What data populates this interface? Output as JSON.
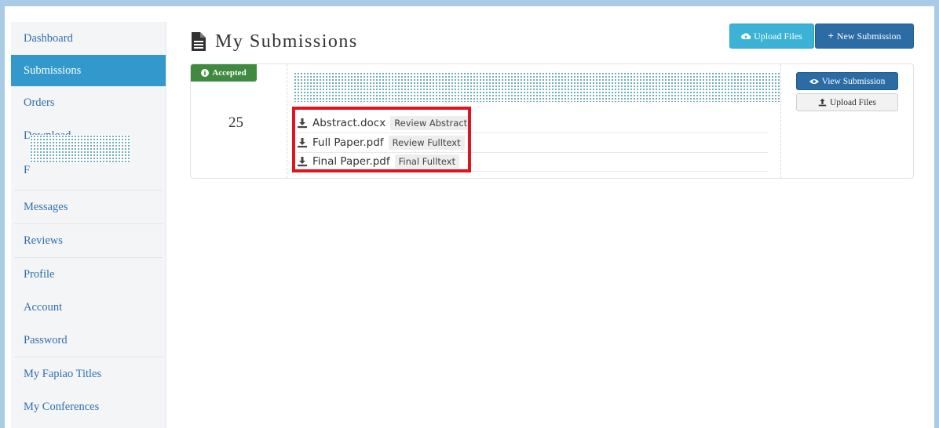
{
  "sidebar": {
    "items": [
      {
        "label": "Dashboard"
      },
      {
        "label": "Submissions"
      },
      {
        "label": "Orders"
      },
      {
        "label": "Download"
      },
      {
        "label": "F"
      },
      {
        "label": "Messages"
      },
      {
        "label": "Reviews"
      },
      {
        "label": "Profile"
      },
      {
        "label": "Account"
      },
      {
        "label": "Password"
      },
      {
        "label": "My Fapiao Titles"
      },
      {
        "label": "My Conferences"
      }
    ],
    "active": "Submissions"
  },
  "header": {
    "title": "My Submissions",
    "title_icon": "document-icon",
    "upload_label": "Upload Files",
    "new_label": "New Submission"
  },
  "submission": {
    "status": "Accepted",
    "number": "25",
    "files": [
      {
        "name": "Abstract.docx",
        "tag": "Review Abstract"
      },
      {
        "name": "Full Paper.pdf",
        "tag": "Review Fulltext"
      },
      {
        "name": "Final Paper.pdf",
        "tag": "Final Fulltext"
      }
    ],
    "view_label": "View Submission",
    "upload_label": "Upload Files"
  },
  "colors": {
    "sidebar_active": "#3399cc",
    "accepted_badge": "#3f8a3e",
    "primary_button": "#2b6ca5",
    "info_button": "#3bb2d6",
    "highlight_box": "#e0141e",
    "page_border": "#a9cbe6"
  }
}
